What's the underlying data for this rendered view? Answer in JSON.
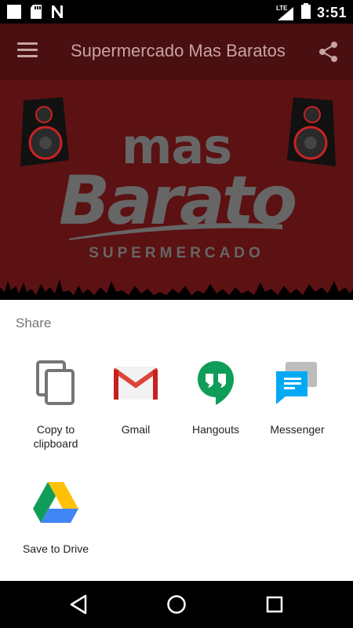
{
  "status_bar": {
    "time": "3:51",
    "network": "LTE",
    "icons": [
      "white-square-icon",
      "sd-card-icon",
      "n-icon",
      "signal-icon",
      "battery-icon"
    ]
  },
  "app_bar": {
    "title": "Supermercado Mas Baratos",
    "icons": [
      "hamburger-menu-icon",
      "share-icon"
    ]
  },
  "hero": {
    "logo_top": "mas",
    "logo_main": "Barato",
    "logo_sub": "SUPERMERCADO"
  },
  "share_sheet": {
    "title": "Share",
    "targets": [
      {
        "label": "Copy to clipboard",
        "icon": "copy-icon"
      },
      {
        "label": "Gmail",
        "icon": "gmail-icon"
      },
      {
        "label": "Hangouts",
        "icon": "hangouts-icon"
      },
      {
        "label": "Messenger",
        "icon": "messenger-icon"
      },
      {
        "label": "Save to Drive",
        "icon": "drive-icon"
      }
    ]
  },
  "nav_bar": {
    "icons": [
      "back-icon",
      "home-icon",
      "recents-icon"
    ]
  },
  "colors": {
    "app_bar": "#4a0f10",
    "hero_bg": "#5c1112",
    "sheet_bg": "#ffffff"
  }
}
